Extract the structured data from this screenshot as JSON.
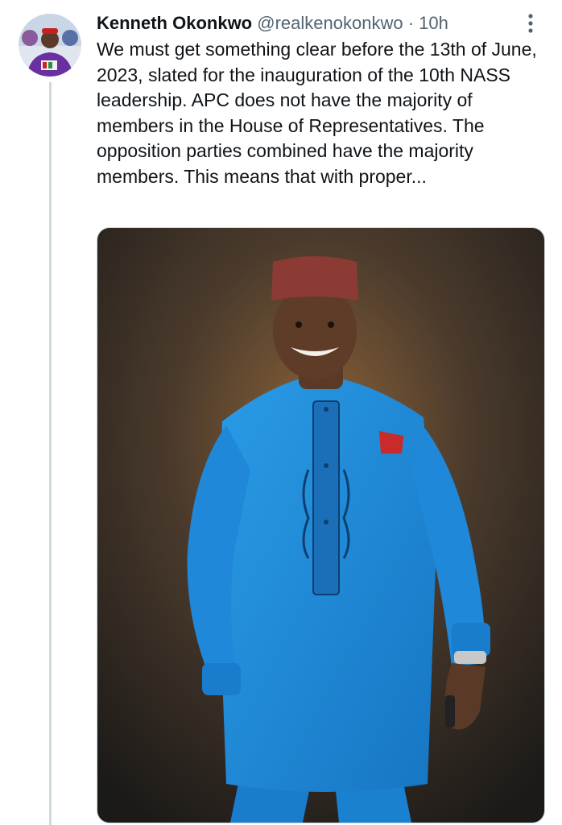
{
  "tweet": {
    "author_name": "Kenneth Okonkwo",
    "author_handle": "@realkenokonkwo",
    "separator": "·",
    "time": "10h",
    "text": "We must get something clear before the 13th of June, 2023, slated for the inauguration of the 10th NASS leadership. APC does not have the majority of members in the House of Representatives. The opposition parties combined have the majority members. This means that with proper...",
    "more_icon": "vertical-dots-icon",
    "avatar_icon": "avatar"
  },
  "colors": {
    "name": "#0f1419",
    "muted": "#536471",
    "thread_line": "#cfd9de",
    "agbada_blue": "#1e8ad6"
  }
}
